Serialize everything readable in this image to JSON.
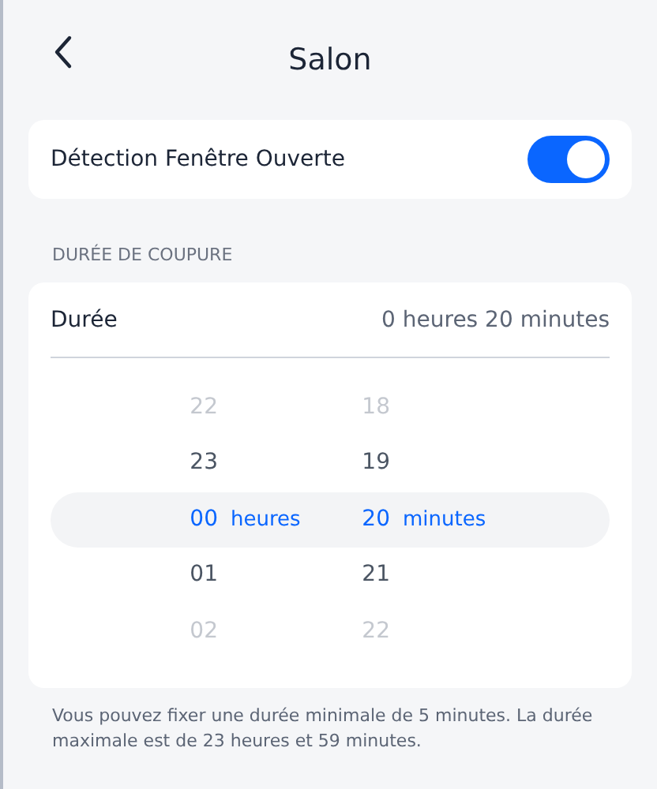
{
  "header": {
    "title": "Salon"
  },
  "window_detection": {
    "label": "Détection Fenêtre Ouverte",
    "on": true
  },
  "section_title": "DURÉE DE COUPURE",
  "duration": {
    "label": "Durée",
    "value": "0 heures 20 minutes"
  },
  "picker": {
    "hours_unit": "heures",
    "minutes_unit": "minutes",
    "rows": [
      {
        "hours": "22",
        "minutes": "18",
        "selected": false,
        "dim": true
      },
      {
        "hours": "23",
        "minutes": "19",
        "selected": false,
        "dim": false
      },
      {
        "hours": "00",
        "minutes": "20",
        "selected": true,
        "dim": false
      },
      {
        "hours": "01",
        "minutes": "21",
        "selected": false,
        "dim": false
      },
      {
        "hours": "02",
        "minutes": "22",
        "selected": false,
        "dim": true
      }
    ]
  },
  "footnote": "Vous pouvez fixer une durée minimale de 5 minutes. La durée maximale est de 23 heures et 59 minutes."
}
